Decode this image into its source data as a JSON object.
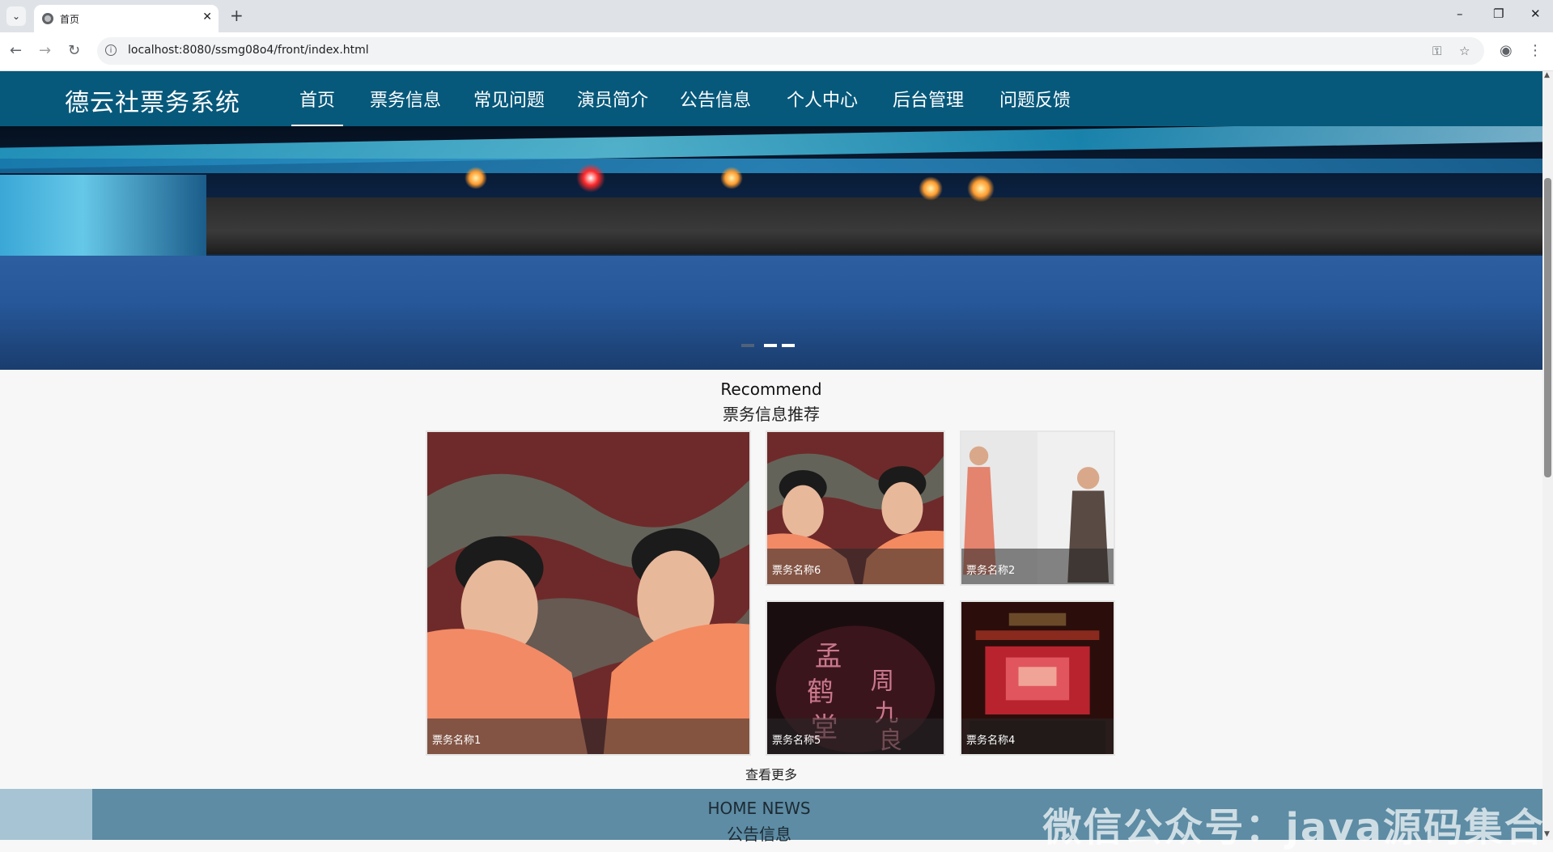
{
  "browser": {
    "tab_title": "首页",
    "url": "localhost:8080/ssmg08o4/front/index.html",
    "tab_list_icon": "chevron-down-icon",
    "new_tab_symbol": "+",
    "close_symbol": "✕",
    "minimize_symbol": "–",
    "restore_symbol": "❐",
    "window_close_symbol": "✕"
  },
  "site": {
    "title": "德云社票务系统",
    "menu": [
      {
        "label": "首页",
        "active": true
      },
      {
        "label": "票务信息",
        "active": false
      },
      {
        "label": "常见问题",
        "active": false
      },
      {
        "label": "演员简介",
        "active": false
      },
      {
        "label": "公告信息",
        "active": false
      },
      {
        "label": "个人中心",
        "active": false
      },
      {
        "label": "后台管理",
        "active": false
      },
      {
        "label": "问题反馈",
        "active": false
      }
    ],
    "brand_color": "#07597b"
  },
  "banner": {
    "slides_count": 3,
    "active_slide": 1
  },
  "recommend": {
    "title_en": "Recommend",
    "title_cn": "票务信息推荐",
    "cards": [
      {
        "name": "票务名称1"
      },
      {
        "name": "票务名称6"
      },
      {
        "name": "票务名称2"
      },
      {
        "name": "票务名称5"
      },
      {
        "name": "票务名称4"
      }
    ],
    "more_label": "查看更多"
  },
  "news": {
    "title_en": "HOME NEWS",
    "title_cn": "公告信息"
  },
  "watermark": "微信公众号：java源码集合"
}
